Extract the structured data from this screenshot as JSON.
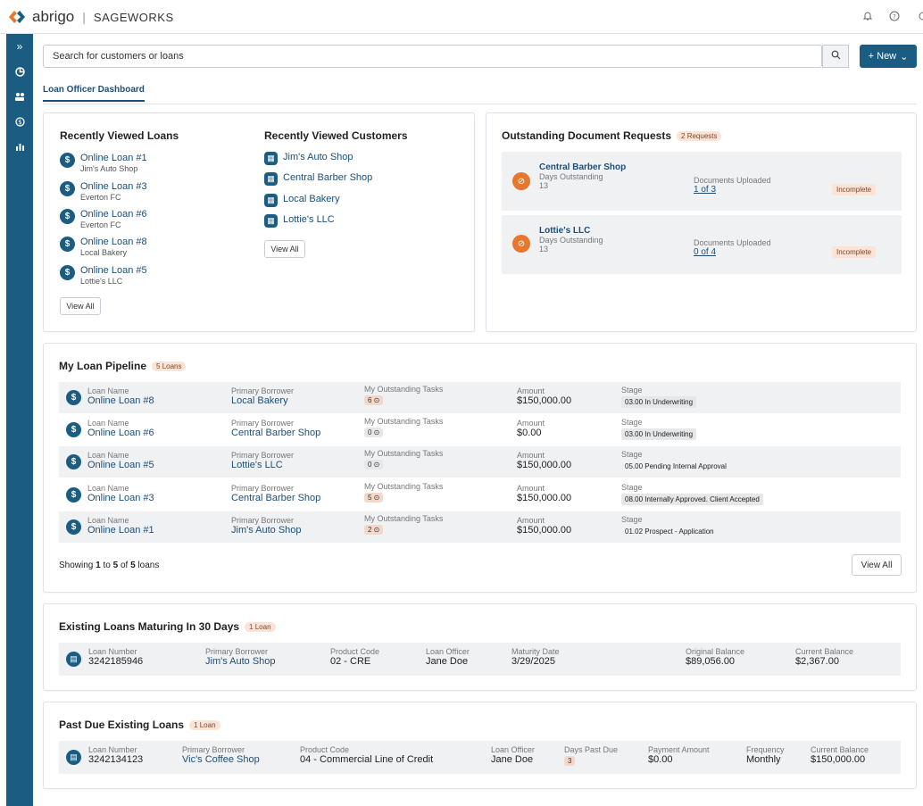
{
  "header": {
    "brand": "abrigo",
    "product": "SAGEWORKS"
  },
  "search": {
    "placeholder": "Search for customers or loans",
    "new_label": "+ New"
  },
  "tabs": {
    "active": "Loan Officer Dashboard"
  },
  "recently_viewed_loans": {
    "title": "Recently Viewed Loans",
    "items": [
      {
        "name": "Online Loan #1",
        "borrower": "Jim's Auto Shop"
      },
      {
        "name": "Online Loan #3",
        "borrower": "Everton FC"
      },
      {
        "name": "Online Loan #6",
        "borrower": "Everton FC"
      },
      {
        "name": "Online Loan #8",
        "borrower": "Local Bakery"
      },
      {
        "name": "Online Loan #5",
        "borrower": "Lottie's LLC"
      }
    ],
    "view_all": "View All"
  },
  "recently_viewed_customers": {
    "title": "Recently Viewed Customers",
    "items": [
      "Jim's Auto Shop",
      "Central Barber Shop",
      "Local Bakery",
      "Lottie's LLC"
    ],
    "view_all": "View All"
  },
  "doc_requests": {
    "title": "Outstanding Document Requests",
    "badge": "2 Requests",
    "items": [
      {
        "name": "Central Barber Shop",
        "days_label": "Days Outstanding",
        "days": "13",
        "uploaded_label": "Documents Uploaded",
        "uploaded": "1 of 3",
        "status": "Incomplete"
      },
      {
        "name": "Lottie's LLC",
        "days_label": "Days Outstanding",
        "days": "13",
        "uploaded_label": "Documents Uploaded",
        "uploaded": "0 of 4",
        "status": "Incomplete"
      }
    ]
  },
  "pipeline": {
    "title": "My Loan Pipeline",
    "badge": "5 Loans",
    "labels": {
      "loan_name": "Loan Name",
      "borrower": "Primary Borrower",
      "tasks": "My Outstanding Tasks",
      "amount": "Amount",
      "stage": "Stage"
    },
    "rows": [
      {
        "loan": "Online Loan #8",
        "borrower": "Local Bakery",
        "tasks": "6 ⊙",
        "amount": "$150,000.00",
        "stage": "03.00 In Underwriting"
      },
      {
        "loan": "Online Loan #6",
        "borrower": "Central Barber Shop",
        "tasks": "0 ⊙",
        "amount": "$0.00",
        "stage": "03.00 In Underwriting"
      },
      {
        "loan": "Online Loan #5",
        "borrower": "Lottie's LLC",
        "tasks": "0 ⊙",
        "amount": "$150,000.00",
        "stage": "05.00 Pending Internal Approval"
      },
      {
        "loan": "Online Loan #3",
        "borrower": "Central Barber Shop",
        "tasks": "5 ⊙",
        "amount": "$150,000.00",
        "stage": "08.00 Internally Approved. Client Accepted"
      },
      {
        "loan": "Online Loan #1",
        "borrower": "Jim's Auto Shop",
        "tasks": "2 ⊙",
        "amount": "$150,000.00",
        "stage": "01.02 Prospect - Application"
      }
    ],
    "showing": {
      "pre": "Showing ",
      "from": "1",
      "mid1": " to ",
      "to": "5",
      "mid2": " of ",
      "total": "5",
      "post": " loans"
    },
    "view_all": "View All"
  },
  "maturing": {
    "title": "Existing Loans Maturing In 30 Days",
    "badge": "1 Loan",
    "labels": {
      "number": "Loan Number",
      "borrower": "Primary Borrower",
      "product": "Product Code",
      "officer": "Loan Officer",
      "maturity": "Maturity Date",
      "original": "Original Balance",
      "current": "Current Balance"
    },
    "row": {
      "number": "3242185946",
      "borrower": "Jim's Auto Shop",
      "product": "02 - CRE",
      "officer": "Jane Doe",
      "maturity": "3/29/2025",
      "original": "$89,056.00",
      "current": "$2,367.00"
    }
  },
  "past_due": {
    "title": "Past Due Existing Loans",
    "badge": "1 Loan",
    "labels": {
      "number": "Loan Number",
      "borrower": "Primary Borrower",
      "product": "Product Code",
      "officer": "Loan Officer",
      "days": "Days Past Due",
      "payment": "Payment Amount",
      "frequency": "Frequency",
      "current": "Current Balance"
    },
    "row": {
      "number": "3242134123",
      "borrower": "Vic's Coffee Shop",
      "product": "04 - Commercial Line of Credit",
      "officer": "Jane Doe",
      "days": "3",
      "payment": "$0.00",
      "frequency": "Monthly",
      "current": "$150,000.00"
    }
  },
  "colors": {
    "brand": "#1a5c82",
    "accent": "#e8772e",
    "badge_bg": "#fbe3d6"
  }
}
